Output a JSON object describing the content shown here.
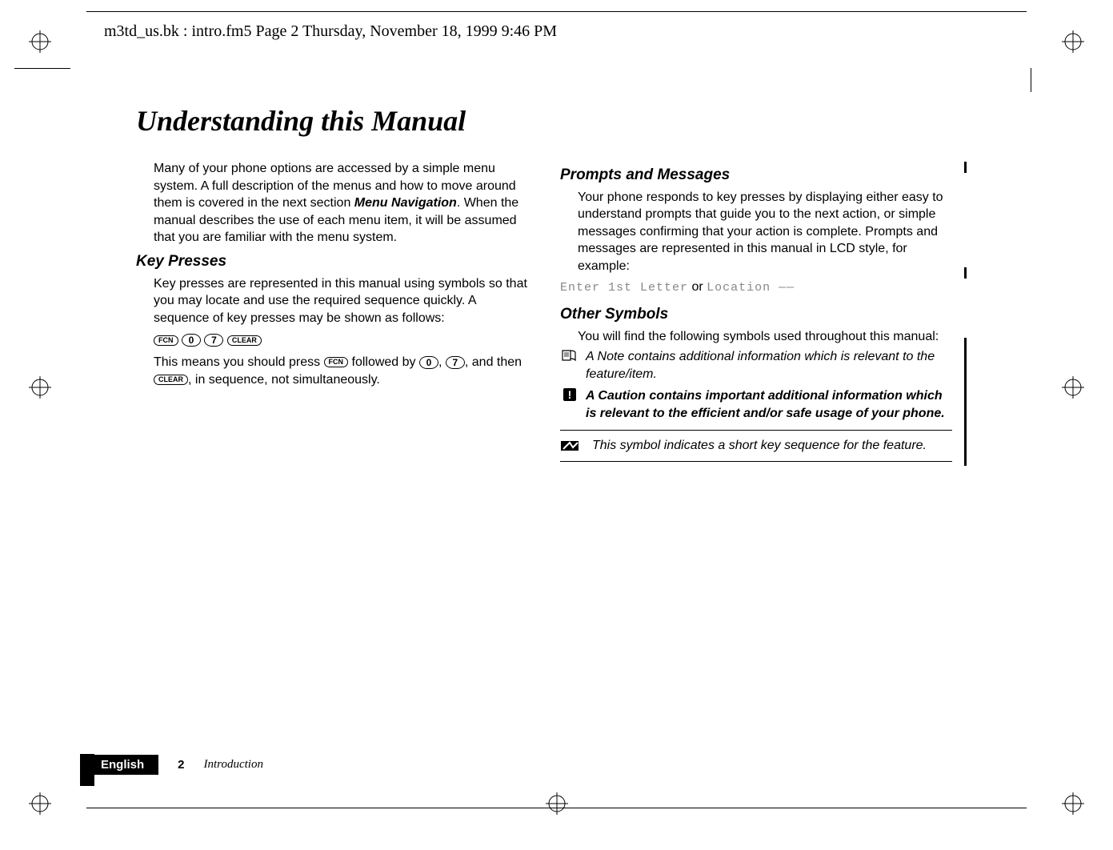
{
  "running_head": "m3td_us.bk : intro.fm5  Page 2  Thursday, November 18, 1999  9:46 PM",
  "title": "Understanding this Manual",
  "left_column": {
    "intro_para": "Many of your phone options are accessed by a simple menu system. A full description of the menus and how to move around them is covered in the next section ",
    "intro_bold": "Menu Navigation",
    "intro_para_cont": ". When the manual describes the use of each menu item, it will be assumed that you are familiar with the menu system.",
    "section1_heading": "Key Presses",
    "section1_para": "Key presses are represented in this manual using symbols so that you may locate and use the required sequence quickly. A sequence of key presses may be shown as follows:",
    "keys": {
      "fcn": "FCN",
      "zero": "0",
      "seven": "7",
      "clear": "CLEAR"
    },
    "section1_expl_a": "This means you should press ",
    "section1_expl_b": " followed by ",
    "section1_expl_c": ", ",
    "section1_expl_d": ", and then ",
    "section1_expl_e": ", in sequence, not simultaneously."
  },
  "right_column": {
    "section2_heading": "Prompts and Messages",
    "section2_para": "Your phone responds to key presses by displaying either easy to understand prompts that guide you to the next action, or simple messages confirming that your action is complete. Prompts and messages are represented in this manual in LCD style, for example:",
    "lcd_example_1": "Enter 1st Letter",
    "lcd_join": " or ",
    "lcd_example_2": "Location ——",
    "section3_heading": "Other Symbols",
    "section3_para": "You will find the following symbols used throughout this manual:",
    "note_text": "A Note contains additional information which is relevant to the feature/item.",
    "caution_text": "A Caution contains important additional information which is relevant to the efficient and/or safe usage of your phone.",
    "shortcut_text": "This symbol indicates a short key sequence for the feature."
  },
  "footer": {
    "language": "English",
    "page_number": "2",
    "chapter": "Introduction"
  }
}
